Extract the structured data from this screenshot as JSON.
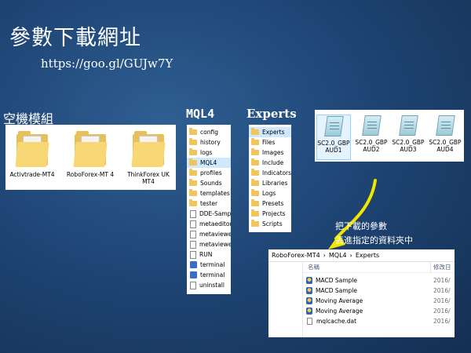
{
  "slide": {
    "title": "參數下載網址",
    "url": "https://goo.gl/GUJw7Y"
  },
  "labels": {
    "empty_template": "空機模組",
    "mql4": "MQL4",
    "experts": "Experts"
  },
  "platforms": [
    {
      "label": "Activtrade-MT4",
      "icon": "folder-icon"
    },
    {
      "label": "RoboForex-MT 4",
      "icon": "folder-icon"
    },
    {
      "label": "ThinkForex UK MT4",
      "icon": "folder-icon"
    }
  ],
  "mql4_items": [
    {
      "label": "config",
      "icon": "folder-icon"
    },
    {
      "label": "history",
      "icon": "folder-icon"
    },
    {
      "label": "logs",
      "icon": "folder-icon"
    },
    {
      "label": "MQL4",
      "icon": "folder-icon",
      "selected": true
    },
    {
      "label": "profiles",
      "icon": "folder-icon"
    },
    {
      "label": "Sounds",
      "icon": "folder-icon"
    },
    {
      "label": "templates",
      "icon": "folder-icon"
    },
    {
      "label": "tester",
      "icon": "folder-icon"
    },
    {
      "label": "DDE-Samp",
      "icon": "file-icon"
    },
    {
      "label": "metaeditor",
      "icon": "file-icon"
    },
    {
      "label": "metaviewer",
      "icon": "file-icon"
    },
    {
      "label": "metaviewer",
      "icon": "file-icon"
    },
    {
      "label": "RUN",
      "icon": "file-icon"
    },
    {
      "label": "terminal",
      "icon": "exe-icon"
    },
    {
      "label": "terminal",
      "icon": "exe-icon"
    },
    {
      "label": "uninstall",
      "icon": "file-icon"
    }
  ],
  "experts_items": [
    {
      "label": "Experts",
      "selected": true
    },
    {
      "label": "Files"
    },
    {
      "label": "Images"
    },
    {
      "label": "Include"
    },
    {
      "label": "Indicators"
    },
    {
      "label": "Libraries"
    },
    {
      "label": "Logs"
    },
    {
      "label": "Presets"
    },
    {
      "label": "Projects"
    },
    {
      "label": "Scripts"
    }
  ],
  "param_files": [
    {
      "label": "SC2.0_GBP AUD1",
      "selected": true
    },
    {
      "label": "SC2.0_GBP AUD2"
    },
    {
      "label": "SC2.0_GBP AUD3"
    },
    {
      "label": "SC2.0_GBP AUD4"
    }
  ],
  "note": {
    "line1": "把下載的參數",
    "line2": "丟進指定的資料夾中"
  },
  "explorer": {
    "breadcrumb": [
      "RoboForex-MT4",
      "›",
      "MQL4",
      "›",
      "Experts"
    ],
    "col_name": "名稱",
    "col_date": "修改日",
    "rows": [
      {
        "name": "MACD Sample",
        "date": "2016/",
        "icon": "expert-icon"
      },
      {
        "name": "MACD Sample",
        "date": "2016/",
        "icon": "expert-icon"
      },
      {
        "name": "Moving Average",
        "date": "2016/",
        "icon": "expert-icon"
      },
      {
        "name": "Moving Average",
        "date": "2016/",
        "icon": "expert-icon"
      },
      {
        "name": "mqlcache.dat",
        "date": "2016/",
        "icon": "file-icon"
      }
    ]
  },
  "colors": {
    "background": "#1f4676",
    "arrow": "#f2e500",
    "folder": "#f2c55c",
    "selection": "#cde8ff"
  }
}
